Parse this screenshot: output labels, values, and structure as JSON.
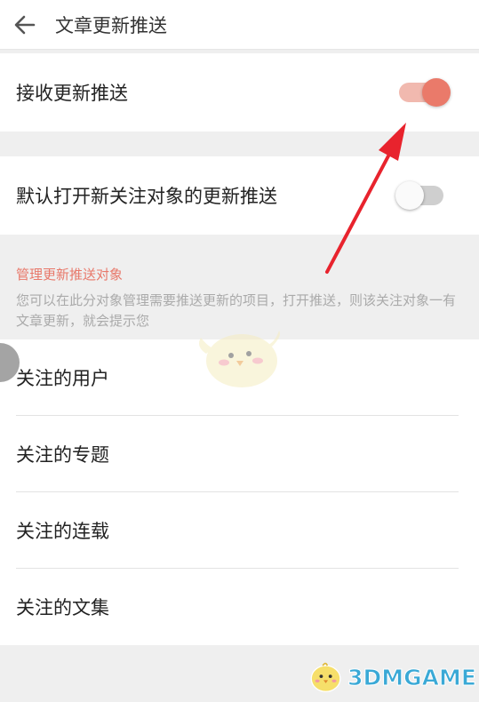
{
  "header": {
    "title": "文章更新推送",
    "back_icon": "back-arrow-icon"
  },
  "settings": {
    "receive_push": {
      "label": "接收更新推送",
      "enabled": true
    },
    "default_open": {
      "label": "默认打开新关注对象的更新推送",
      "enabled": false
    }
  },
  "manage_section": {
    "title": "管理更新推送对象",
    "description": "您可以在此分对象管理需要推送更新的项目，打开推送，则该关注对象一有文章更新，就会提示您"
  },
  "list": [
    {
      "label": "关注的用户"
    },
    {
      "label": "关注的专题"
    },
    {
      "label": "关注的连载"
    },
    {
      "label": "关注的文集"
    }
  ],
  "watermark": {
    "text": "3DMGAME"
  },
  "colors": {
    "accent": "#ea7a6a",
    "accent_light": "#f1b9af",
    "annotation_arrow": "#e8232d",
    "watermark": "#3aa9d6"
  }
}
